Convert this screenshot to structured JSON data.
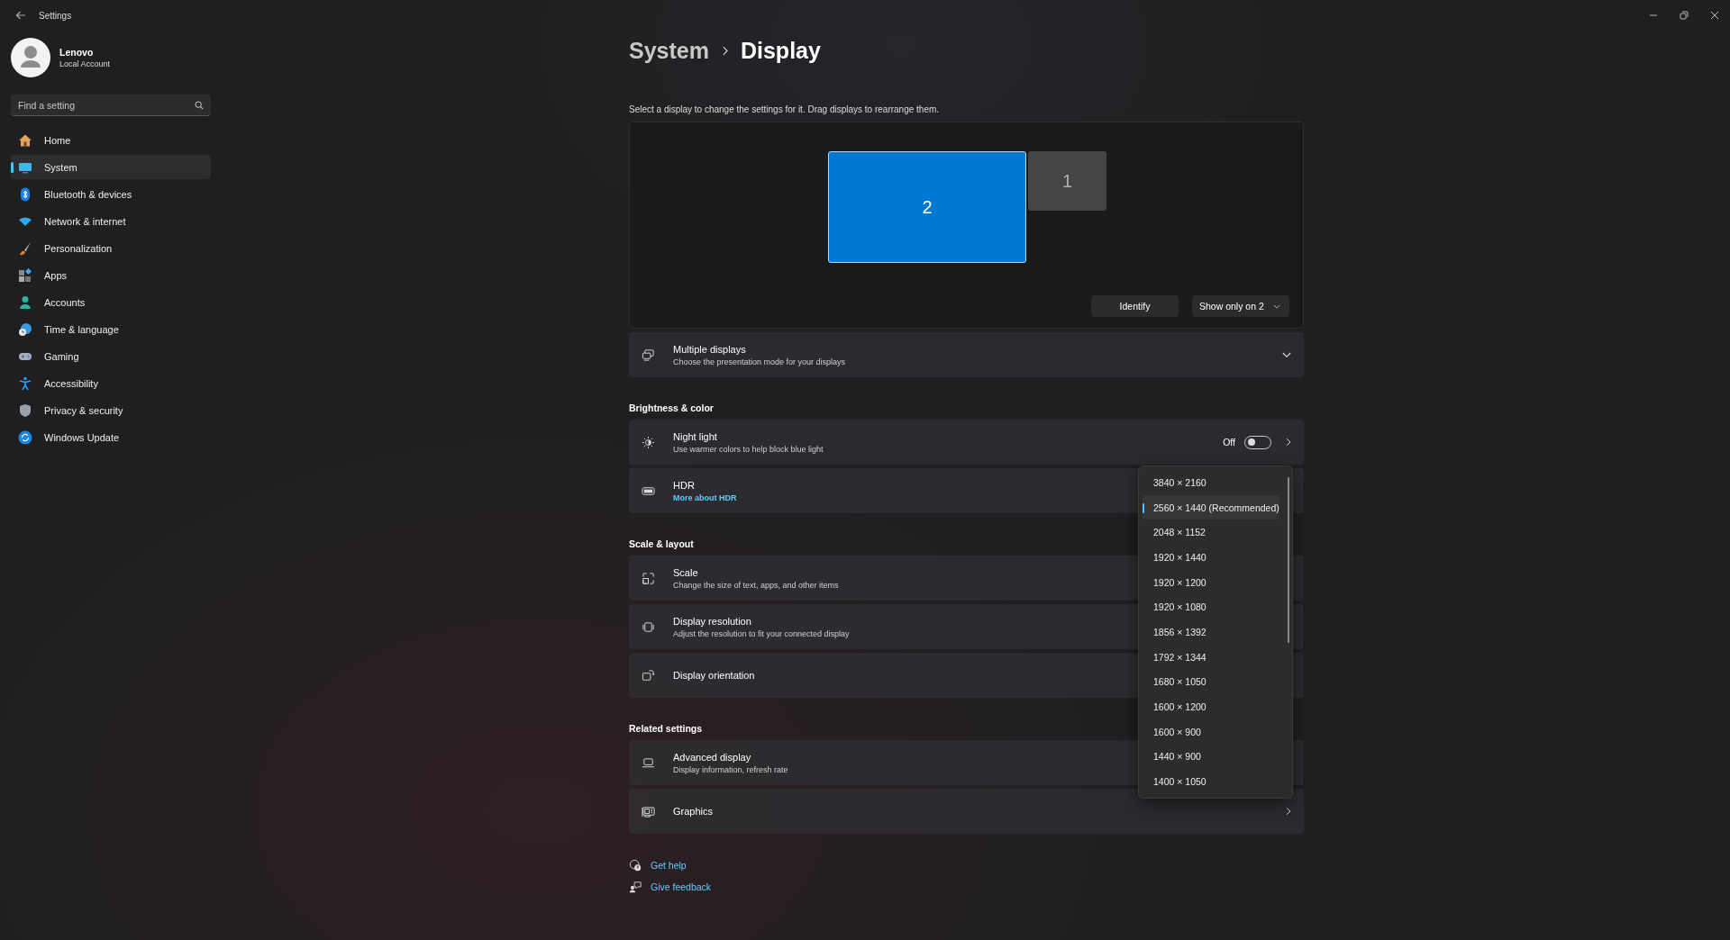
{
  "window": {
    "title": "Settings"
  },
  "account": {
    "name": "Lenovo",
    "type": "Local Account"
  },
  "search": {
    "placeholder": "Find a setting"
  },
  "nav": [
    {
      "label": "Home",
      "selected": false
    },
    {
      "label": "System",
      "selected": true
    },
    {
      "label": "Bluetooth & devices",
      "selected": false
    },
    {
      "label": "Network & internet",
      "selected": false
    },
    {
      "label": "Personalization",
      "selected": false
    },
    {
      "label": "Apps",
      "selected": false
    },
    {
      "label": "Accounts",
      "selected": false
    },
    {
      "label": "Time & language",
      "selected": false
    },
    {
      "label": "Gaming",
      "selected": false
    },
    {
      "label": "Accessibility",
      "selected": false
    },
    {
      "label": "Privacy & security",
      "selected": false
    },
    {
      "label": "Windows Update",
      "selected": false
    }
  ],
  "breadcrumb": [
    "System",
    "Display"
  ],
  "arrangement": {
    "instruction": "Select a display to change the settings for it. Drag displays to rearrange them.",
    "displays": [
      {
        "label": "2",
        "selected": true
      },
      {
        "label": "1",
        "selected": false
      }
    ],
    "identify": "Identify",
    "project_mode": "Show only on 2"
  },
  "multiple_displays": {
    "title": "Multiple displays",
    "subtitle": "Choose the presentation mode for your displays",
    "expanded": false
  },
  "sections": [
    {
      "heading": "Brightness & color",
      "rows": [
        {
          "title": "Night light",
          "subtitle": "Use warmer colors to help block blue light",
          "toggle": {
            "label": "Off",
            "on": false
          },
          "chevron": true
        },
        {
          "title": "HDR",
          "link": "More about HDR"
        }
      ]
    },
    {
      "heading": "Scale & layout",
      "rows": [
        {
          "title": "Scale",
          "subtitle": "Change the size of text, apps, and other items"
        },
        {
          "title": "Display resolution",
          "subtitle": "Adjust the resolution to fit your connected display"
        },
        {
          "title": "Display orientation"
        }
      ]
    },
    {
      "heading": "Related settings",
      "rows": [
        {
          "title": "Advanced display",
          "subtitle": "Display information, refresh rate"
        },
        {
          "title": "Graphics",
          "chevron": true
        }
      ]
    }
  ],
  "resolution_menu": [
    {
      "label": "3840 × 2160",
      "selected": false
    },
    {
      "label": "2560 × 1440 (Recommended)",
      "selected": true
    },
    {
      "label": "2048 × 1152",
      "selected": false
    },
    {
      "label": "1920 × 1440",
      "selected": false
    },
    {
      "label": "1920 × 1200",
      "selected": false
    },
    {
      "label": "1920 × 1080",
      "selected": false
    },
    {
      "label": "1856 × 1392",
      "selected": false
    },
    {
      "label": "1792 × 1344",
      "selected": false
    },
    {
      "label": "1680 × 1050",
      "selected": false
    },
    {
      "label": "1600 × 1200",
      "selected": false
    },
    {
      "label": "1600 × 900",
      "selected": false
    },
    {
      "label": "1440 × 900",
      "selected": false
    },
    {
      "label": "1400 × 1050",
      "selected": false
    }
  ],
  "help_links": [
    "Get help",
    "Give feedback"
  ]
}
